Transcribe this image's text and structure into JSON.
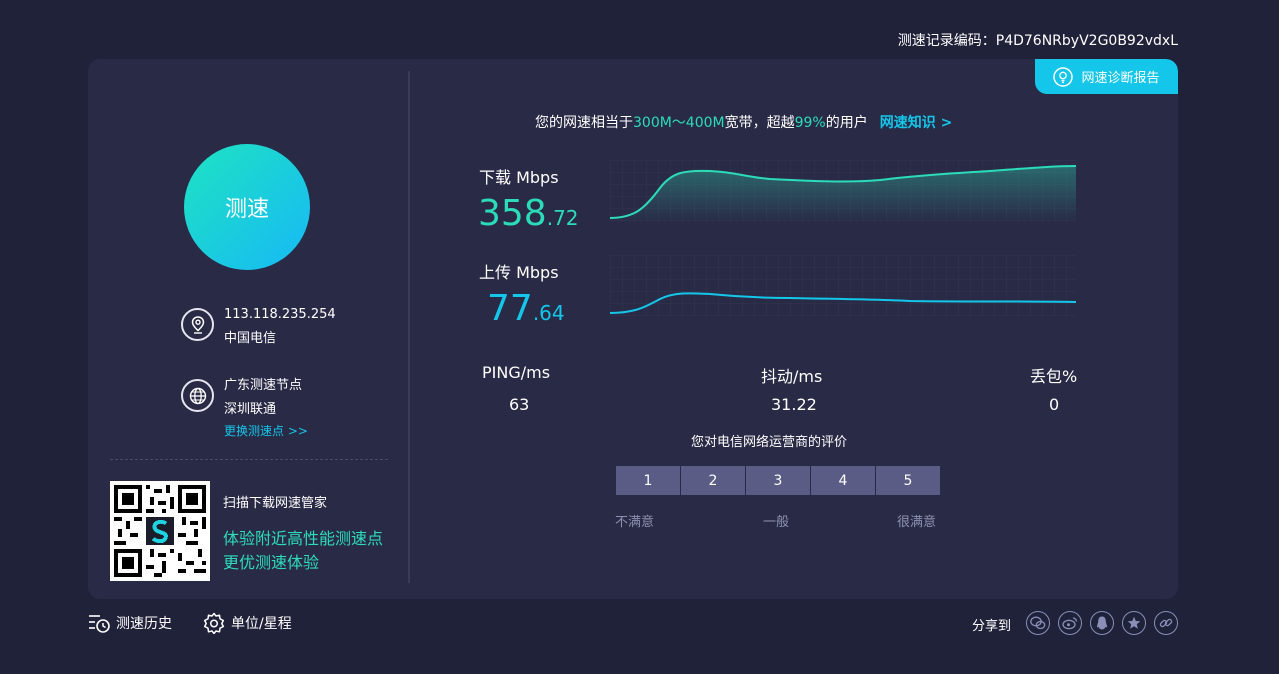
{
  "header": {
    "record_code": "测速记录编码：P4D76NRbyV2G0B92vdxL"
  },
  "diagnose_button": {
    "label": "网速诊断报告",
    "icon": "bulb-icon"
  },
  "start_button": {
    "label": "测速"
  },
  "ip_info": {
    "ip": "113.118.235.254",
    "isp": "中国电信",
    "icon": "location-pin-icon"
  },
  "node_info": {
    "node": "广东测速节点",
    "carrier": "深圳联通",
    "change_link": "更换测速点 >>",
    "icon": "globe-icon"
  },
  "app_promo": {
    "title": "扫描下载网速管家",
    "line1": "体验附近高性能测速点",
    "line2": "更优测速体验"
  },
  "summary": {
    "prefix": "您的网速相当于",
    "range": "300M～400M",
    "mid": "宽带，超越",
    "percent": "99%",
    "suffix": "的用户",
    "knowledge_link": "网速知识 >"
  },
  "download": {
    "label": "下载 Mbps",
    "int": "358",
    "dec": ".72",
    "color": "#2cdcb8"
  },
  "upload": {
    "label": "上传 Mbps",
    "int": "77",
    "dec": ".64",
    "color": "#14c6ea"
  },
  "stats": {
    "ping_label": "PING/ms",
    "ping": "63",
    "jitter_label": "抖动/ms",
    "jitter": "31.22",
    "loss_label": "丢包%",
    "loss": "0"
  },
  "rating": {
    "title": "您对电信网络运营商的评价",
    "options": [
      "1",
      "2",
      "3",
      "4",
      "5"
    ],
    "low": "不满意",
    "mid": "一般",
    "high": "很满意"
  },
  "footer": {
    "history": "测速历史",
    "units": "单位/星程",
    "share_label": "分享到",
    "share_icons": [
      "wechat-icon",
      "weibo-icon",
      "qq-icon",
      "qzone-icon",
      "link-icon"
    ]
  }
}
